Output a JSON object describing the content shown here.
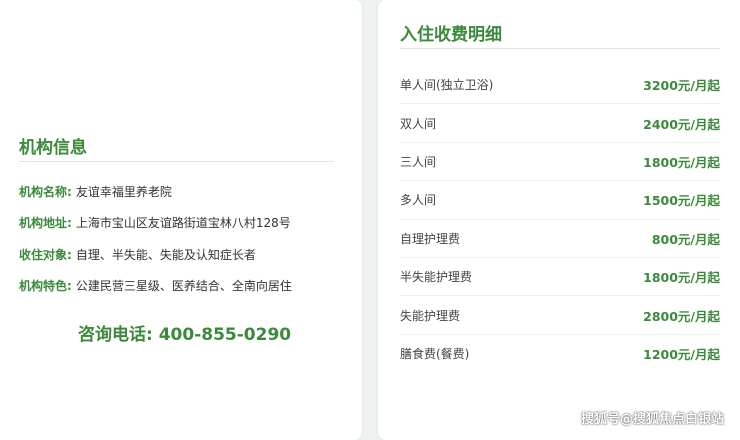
{
  "institution": {
    "title": "机构信息",
    "rows": [
      {
        "label": "机构名称:",
        "value": "友谊幸福里养老院"
      },
      {
        "label": "机构地址:",
        "value": "上海市宝山区友谊路街道宝林八村128号"
      },
      {
        "label": "收住对象:",
        "value": "自理、半失能、失能及认知症长者"
      },
      {
        "label": "机构特色:",
        "value": "公建民营三星级、医养结合、全南向居住"
      }
    ],
    "phone": "咨询电话: 400-855-0290"
  },
  "fees": {
    "title": "入住收费明细",
    "items": [
      {
        "name": "单人间(独立卫浴)",
        "price": "3200元/月起"
      },
      {
        "name": "双人间",
        "price": "2400元/月起"
      },
      {
        "name": "三人间",
        "price": "1800元/月起"
      },
      {
        "name": "多人间",
        "price": "1500元/月起"
      },
      {
        "name": "自理护理费",
        "price": "800元/月起"
      },
      {
        "name": "半失能护理费",
        "price": "1800元/月起"
      },
      {
        "name": "失能护理费",
        "price": "2800元/月起"
      },
      {
        "name": "膳食费(餐费)",
        "price": "1200元/月起"
      }
    ]
  },
  "watermark": "搜狐号@搜狐焦点白银站",
  "colors": {
    "accent": "#3b8a3b",
    "background": "#edf2ee"
  }
}
